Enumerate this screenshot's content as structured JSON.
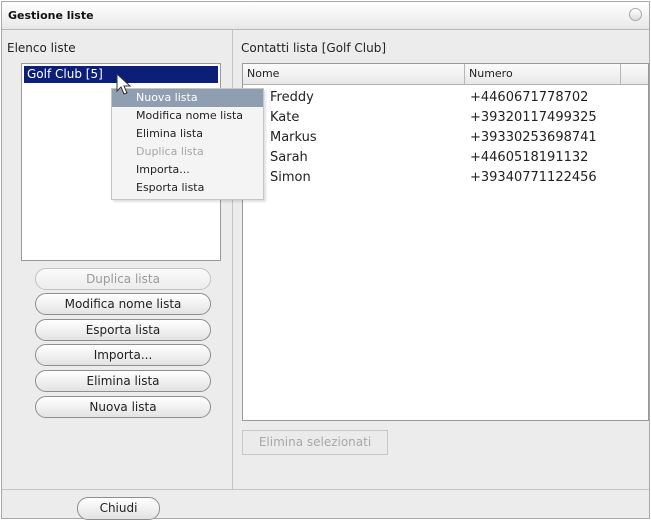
{
  "window": {
    "title": "Gestione liste"
  },
  "left": {
    "heading": "Elenco liste",
    "lists": [
      "Golf Club [5]"
    ],
    "buttons": {
      "duplicate": "Duplica lista",
      "rename": "Modifica nome lista",
      "export": "Esporta lista",
      "import": "Importa...",
      "delete": "Elimina lista",
      "new": "Nuova lista"
    },
    "close": "Chiudi"
  },
  "right": {
    "heading": "Contatti lista [Golf Club]",
    "columns": [
      "Nome",
      "Numero"
    ],
    "rows": [
      {
        "name": "Freddy",
        "number": "+4460671778702"
      },
      {
        "name": "Kate",
        "number": "+39320117499325"
      },
      {
        "name": "Markus",
        "number": "+39330253698741"
      },
      {
        "name": "Sarah",
        "number": "+4460518191132"
      },
      {
        "name": "Simon",
        "number": "+39340771122456"
      }
    ],
    "delete_selected": "Elimina selezionati"
  },
  "context_menu": {
    "items": [
      {
        "label": "Nuova lista",
        "state": "highlighted"
      },
      {
        "label": "Modifica nome lista",
        "state": "enabled"
      },
      {
        "label": "Elimina lista",
        "state": "enabled"
      },
      {
        "label": "Duplica lista",
        "state": "disabled"
      },
      {
        "label": "Importa...",
        "state": "enabled"
      },
      {
        "label": "Esporta lista",
        "state": "enabled"
      }
    ]
  },
  "colors": {
    "selection": "#0b1f79",
    "menu_highlight": "#8f9fb1",
    "window_bg": "#ececec"
  },
  "icons": {
    "cursor": "arrow-pointer-icon",
    "window_control": "circle-button-icon"
  }
}
